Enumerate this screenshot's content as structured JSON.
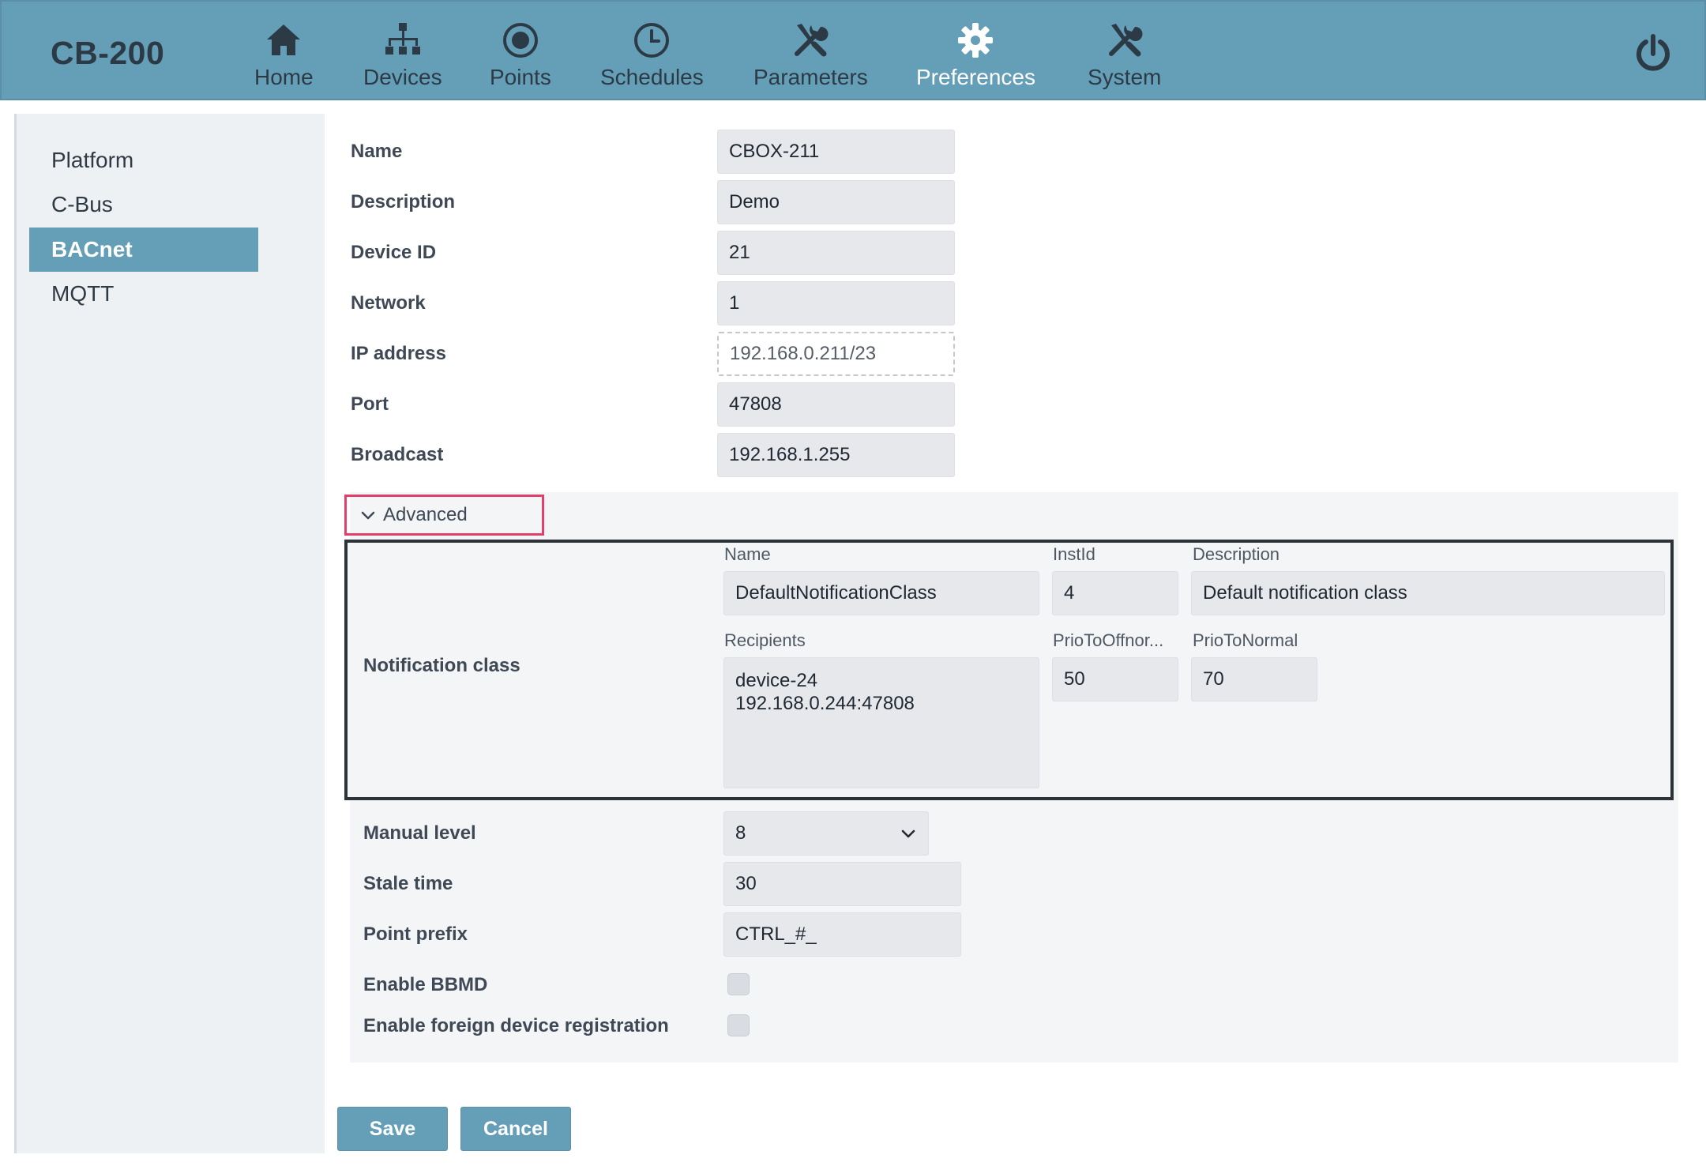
{
  "app": {
    "title": "CB-200"
  },
  "nav": {
    "items": [
      {
        "label": "Home",
        "icon": "home-icon"
      },
      {
        "label": "Devices",
        "icon": "network-icon"
      },
      {
        "label": "Points",
        "icon": "record-icon"
      },
      {
        "label": "Schedules",
        "icon": "clock-icon"
      },
      {
        "label": "Parameters",
        "icon": "tools-icon"
      },
      {
        "label": "Preferences",
        "icon": "gear-icon",
        "active": true
      },
      {
        "label": "System",
        "icon": "tools-icon"
      }
    ],
    "power_icon": "power-icon"
  },
  "sidebar": {
    "items": [
      {
        "label": "Platform"
      },
      {
        "label": "C-Bus"
      },
      {
        "label": "BACnet",
        "active": true
      },
      {
        "label": "MQTT"
      }
    ]
  },
  "form": {
    "name": {
      "label": "Name",
      "value": "CBOX-211"
    },
    "description": {
      "label": "Description",
      "value": "Demo"
    },
    "device_id": {
      "label": "Device ID",
      "value": "21"
    },
    "network": {
      "label": "Network",
      "value": "1"
    },
    "ip_address": {
      "label": "IP address",
      "value": "192.168.0.211/23"
    },
    "port": {
      "label": "Port",
      "value": "47808"
    },
    "broadcast": {
      "label": "Broadcast",
      "value": "192.168.1.255"
    }
  },
  "advanced": {
    "toggle_label": "Advanced",
    "notification_class": {
      "label": "Notification class",
      "name": {
        "label": "Name",
        "value": "DefaultNotificationClass"
      },
      "inst_id": {
        "label": "InstId",
        "value": "4"
      },
      "description": {
        "label": "Description",
        "value": "Default notification class"
      },
      "recipients": {
        "label": "Recipients",
        "value": "device-24\n192.168.0.244:47808"
      },
      "prio_to_offnormal": {
        "label": "PrioToOffnor...",
        "value": "50"
      },
      "prio_to_normal": {
        "label": "PrioToNormal",
        "value": "70"
      }
    },
    "manual_level": {
      "label": "Manual level",
      "value": "8"
    },
    "stale_time": {
      "label": "Stale time",
      "value": "30"
    },
    "point_prefix": {
      "label": "Point prefix",
      "value": "CTRL_#_"
    },
    "enable_bbmd": {
      "label": "Enable BBMD",
      "checked": false
    },
    "enable_foreign": {
      "label": "Enable foreign device registration",
      "checked": false
    }
  },
  "actions": {
    "save_label": "Save",
    "cancel_label": "Cancel"
  },
  "colors": {
    "header": "#659fb7",
    "sidebar_active": "#659fb7",
    "highlight_border": "#e0406a"
  }
}
